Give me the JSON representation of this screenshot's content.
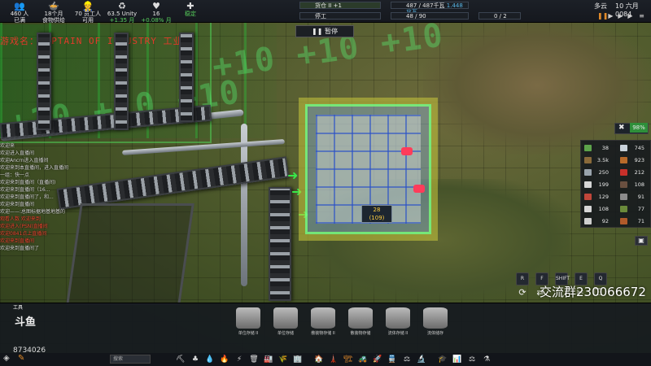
{
  "top_stats": [
    {
      "value": "460 人",
      "label": "已满",
      "icon": "people-icon"
    },
    {
      "value": "18个月",
      "label": "食物供给",
      "icon": "food-bowl-icon"
    },
    {
      "value": "70 员工人",
      "label": "可用",
      "icon": "workers-icon"
    },
    {
      "value": "63.5 Unity",
      "label": "+1.35 月",
      "icon": "recycle-icon"
    },
    {
      "value": "16",
      "label": "+0.08% 月",
      "icon": "heart-icon"
    },
    {
      "value": "",
      "label": "稳定",
      "icon": "health-kit-icon"
    }
  ],
  "resource_bars": {
    "storage": "货仓 II +1",
    "status": "停工",
    "power": "487 / 487千瓦",
    "power_extra": "1.448兆瓦",
    "vehicles": "48 / 90",
    "maintenance": "0 / 2"
  },
  "pause_label": "暂停",
  "weather": {
    "condition": "多云",
    "date": "10 六月 0084"
  },
  "overlay_title": "游戏名：CAPTAIN OF INDUSTRY 工业长",
  "big_overlay_text": "+10 +10 +10",
  "chat_lines": [
    {
      "text": "欢迎来",
      "red": false
    },
    {
      "text": "欢迎进入直播间",
      "red": false
    },
    {
      "text": "欢迎Ancrn进入直播间",
      "red": false
    },
    {
      "text": "欢迎来到本直播间，进入直播间",
      "red": false
    },
    {
      "text": "一组：快一点",
      "red": false
    },
    {
      "text": "欢迎来到直播间（直播间)",
      "red": false
    },
    {
      "text": "欢迎来到直播间（16...",
      "red": false
    },
    {
      "text": "欢迎来到直播间了，和...",
      "red": false
    },
    {
      "text": "欢迎来到直播间",
      "red": false
    },
    {
      "text": "欢迎——:总图标据地基地基的",
      "red": false
    },
    {
      "text": "观看人数 欢迎来到",
      "red": true
    },
    {
      "text": "欢迎进入(PSN)直播间",
      "red": true
    },
    {
      "text": "欢迎0841点上直播间",
      "red": true
    },
    {
      "text": "欢迎来到直播间",
      "red": true
    },
    {
      "text": "欢迎来到直播间了",
      "red": false
    }
  ],
  "resource_panel": {
    "percent": "98%",
    "items": [
      {
        "value": "38",
        "color": "#5da34a"
      },
      {
        "value": "745",
        "color": "#c9d2da"
      },
      {
        "value": "3.5k",
        "color": "#8a6a3a"
      },
      {
        "value": "923",
        "color": "#b86a2a"
      },
      {
        "value": "250",
        "color": "#9aa4ad"
      },
      {
        "value": "212",
        "color": "#c8302a"
      },
      {
        "value": "199",
        "color": "#d6d6d6"
      },
      {
        "value": "108",
        "color": "#6a5040"
      },
      {
        "value": "129",
        "color": "#c0463a"
      },
      {
        "value": "91",
        "color": "#8c8c8c"
      },
      {
        "value": "108",
        "color": "#d6d6d6"
      },
      {
        "value": "77",
        "color": "#6a8a3a"
      },
      {
        "value": "92",
        "color": "#cfcfcf"
      },
      {
        "value": "71",
        "color": "#b05a2a"
      }
    ]
  },
  "ghost_tag": {
    "line1": "28",
    "line2": "(109)"
  },
  "hotkeys": [
    "R",
    "F",
    "SHIFT",
    "E",
    "Q"
  ],
  "watermark": "交流群230066672",
  "build_menu": {
    "tools_label": "工具",
    "items": [
      {
        "label": "单位存储 II"
      },
      {
        "label": "单位存储"
      },
      {
        "label": "散装物存储 II"
      },
      {
        "label": "散装物存储"
      },
      {
        "label": "流体存储 II"
      },
      {
        "label": "流体储存"
      }
    ]
  },
  "search_placeholder": "搜索",
  "user_id": "8734026",
  "logo_text": "斗鱼"
}
